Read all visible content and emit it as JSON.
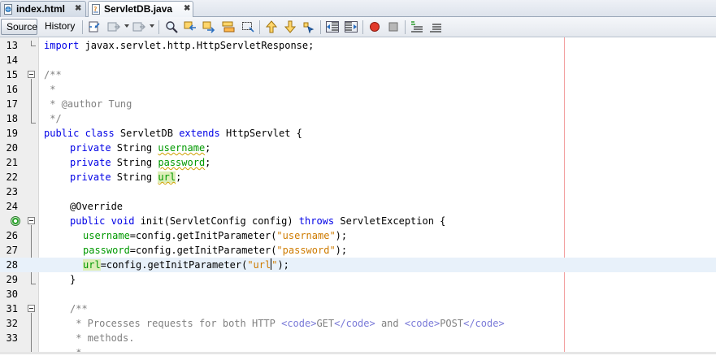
{
  "tabs": [
    {
      "label": "index.html",
      "close": "✖",
      "active": false
    },
    {
      "label": "ServletDB.java",
      "close": "✖",
      "active": true
    }
  ],
  "view_buttons": {
    "source": "Source",
    "history": "History"
  },
  "toolbar_icons": [
    "last-edit-icon",
    "back-icon",
    "forward-icon",
    "find-icon",
    "find-previous-icon",
    "find-next-icon",
    "toggle-highlight-icon",
    "find-selection-icon",
    "previous-bookmark-icon",
    "next-bookmark-icon",
    "toggle-bookmark-icon",
    "shift-left-icon",
    "shift-right-icon",
    "start-macro-icon",
    "stop-macro-icon",
    "comment-icon",
    "uncomment-icon"
  ],
  "colors": {
    "keyword": "#0000e6",
    "string": "#ce7b00",
    "field": "#009900",
    "comment": "#969696",
    "current_line": "#e8f1fa",
    "right_margin": "#f3a0a0"
  },
  "editor": {
    "lines": [
      {
        "n": "13",
        "t": {
          "kw": "import",
          "rest": " javax.servlet.http.HttpServletResponse;"
        }
      },
      {
        "n": "14"
      },
      {
        "n": "15",
        "t": {
          "jd": "/**"
        }
      },
      {
        "n": "16",
        "t": {
          "jd": " *"
        }
      },
      {
        "n": "17",
        "t": {
          "jd": " * @author Tung"
        }
      },
      {
        "n": "18",
        "t": {
          "jd": " */"
        }
      },
      {
        "n": "19",
        "t": {
          "kw1": "public class",
          "a": " ServletDB ",
          "kw2": "extends",
          "b": " HttpServlet {"
        }
      },
      {
        "n": "20",
        "t": {
          "kw": "private",
          "a": " String ",
          "f": "username",
          "b": ";"
        }
      },
      {
        "n": "21",
        "t": {
          "kw": "private",
          "a": " String ",
          "f": "password",
          "b": ";"
        }
      },
      {
        "n": "22",
        "t": {
          "kw": "private",
          "a": " String ",
          "f": "url",
          "b": ";"
        }
      },
      {
        "n": "23"
      },
      {
        "n": "24",
        "t": {
          "a": "@Override"
        }
      },
      {
        "n": "",
        "t": {
          "kw1": "public void",
          "a": " init(ServletConfig config) ",
          "kw2": "throws",
          "b": " ServletException {"
        }
      },
      {
        "n": "26",
        "t": {
          "f": "username",
          "a": "=config.getInitParameter(",
          "s": "\"username\"",
          "b": ");"
        }
      },
      {
        "n": "27",
        "t": {
          "f": "password",
          "a": "=config.getInitParameter(",
          "s": "\"password\"",
          "b": ");"
        }
      },
      {
        "n": "28",
        "t": {
          "f": "url",
          "a": "=config.getInitParameter(",
          "s1": "\"url",
          "s2": "\"",
          "b": ");"
        }
      },
      {
        "n": "29",
        "t": {
          "a": "}"
        }
      },
      {
        "n": "30"
      },
      {
        "n": "31",
        "t": {
          "jd": "/**"
        }
      },
      {
        "n": "32",
        "t": {
          "jd": " * Processes requests for both HTTP ",
          "tg1": "<code>",
          "x1": "GET",
          "tg2": "</code>",
          "x2": " and ",
          "tg3": "<code>",
          "x3": "POST",
          "tg4": "</code>"
        }
      },
      {
        "n": "33",
        "t": {
          "jd": " * methods."
        }
      },
      {
        "n": "",
        "t": {
          "jd": " *"
        }
      }
    ]
  }
}
